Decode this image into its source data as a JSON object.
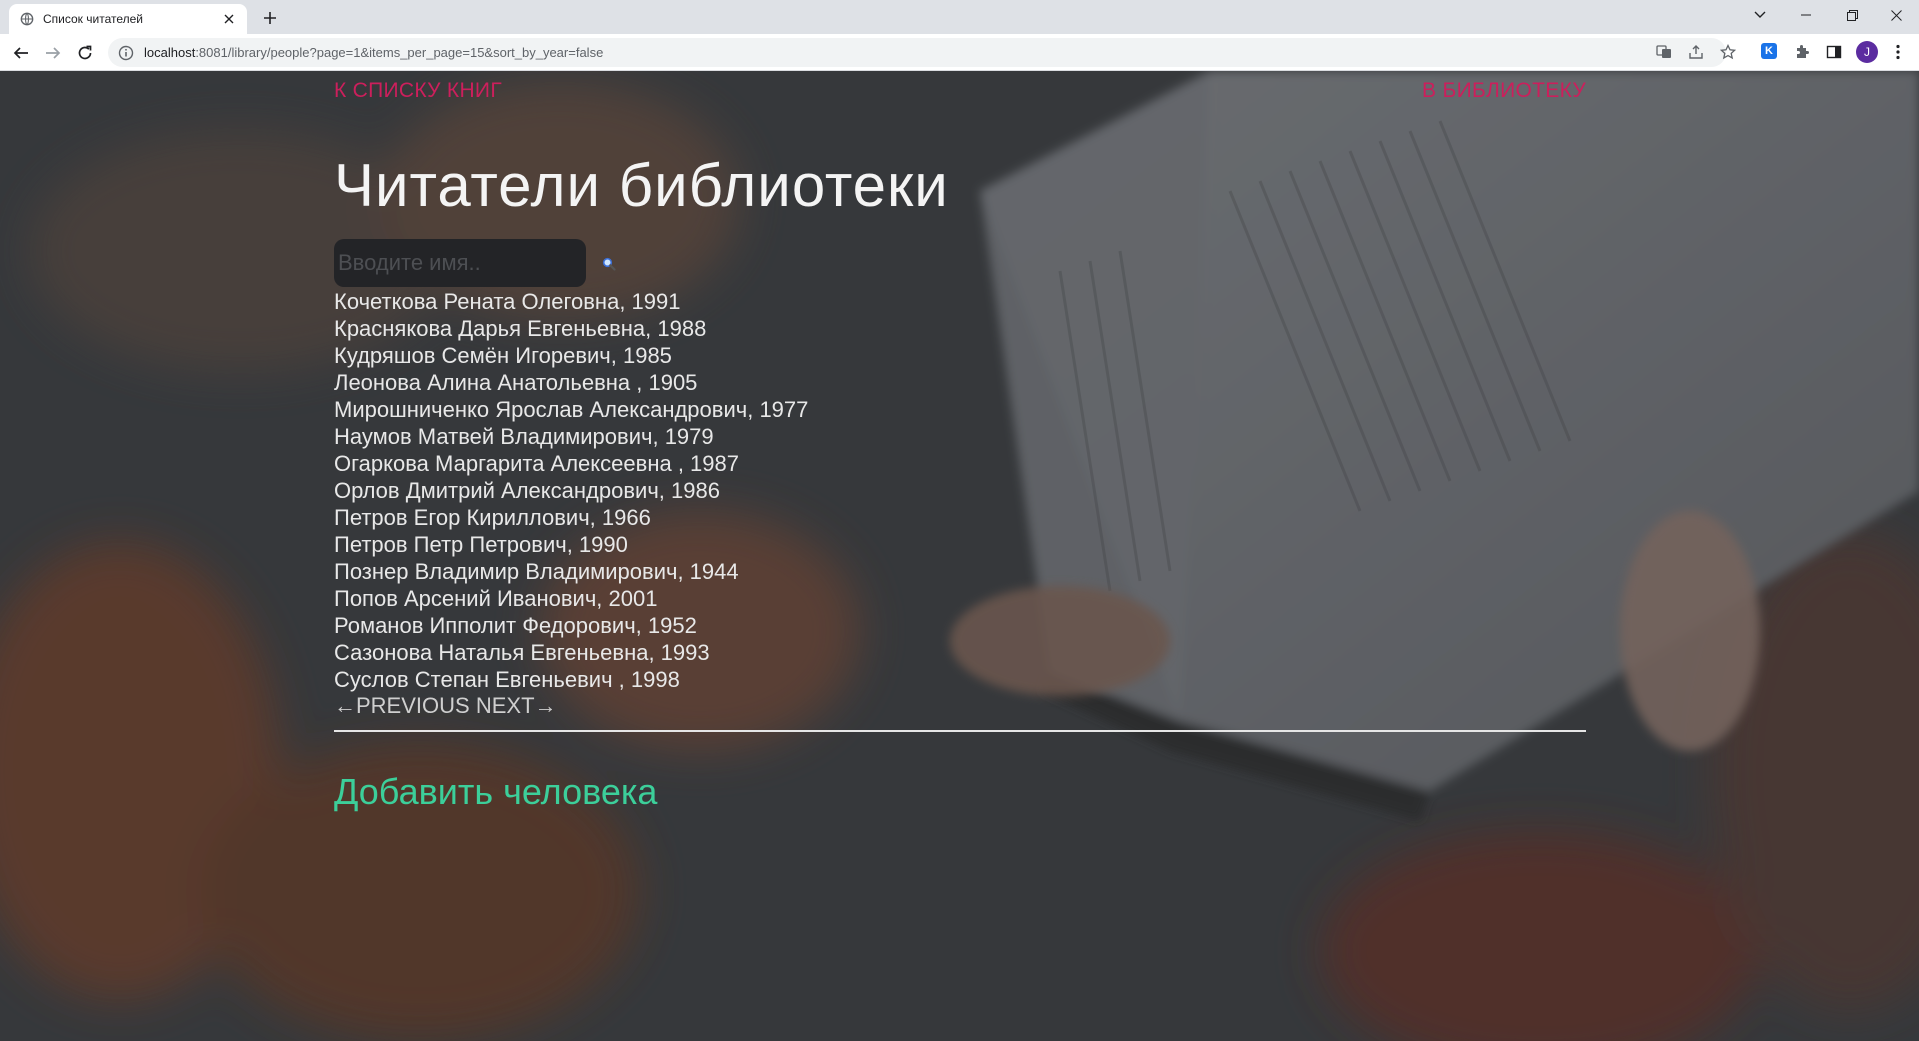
{
  "browser": {
    "tab_title": "Список читателей",
    "url_host": "localhost",
    "url_path": ":8081/library/people?page=1&items_per_page=15&sort_by_year=false",
    "profile_initial": "J",
    "extension_letter": "K"
  },
  "nav": {
    "back_to_books": "К СПИСКУ КНИГ",
    "to_library": "В БИБЛИОТЕКУ"
  },
  "page": {
    "title": "Читатели библиотеки"
  },
  "search": {
    "placeholder": "Вводите имя..",
    "icon": "magnifier-icon"
  },
  "people": [
    "Кочеткова Рената Олеговна, 1991",
    "Краснякова Дарья Евгеньевна, 1988",
    "Кудряшов Семён Игоревич, 1985",
    "Леонова Алина Анатольевна , 1905",
    "Мирошниченко Ярослав Александрович, 1977",
    "Наумов Матвей Владимирович, 1979",
    "Огаркова Маргарита Алексеевна , 1987",
    "Орлов Дмитрий Александрович, 1986",
    "Петров Егор Кириллович, 1966",
    "Петров Петр Петрович, 1990",
    "Познер Владимир Владимирович, 1944",
    "Попов Арсений Иванович, 2001",
    "Романов Ипполит Федорович, 1952",
    "Сазонова Наталья Евгеньевна, 1993",
    "Суслов Степан Евгеньевич , 1998"
  ],
  "pager": {
    "previous": "←PREVIOUS",
    "next": "NEXT→"
  },
  "add_person": "Добавить человека",
  "colors": {
    "accent_link": "#cc1f5c",
    "add_link": "#3ccf9a",
    "text": "#e8e8e8"
  }
}
